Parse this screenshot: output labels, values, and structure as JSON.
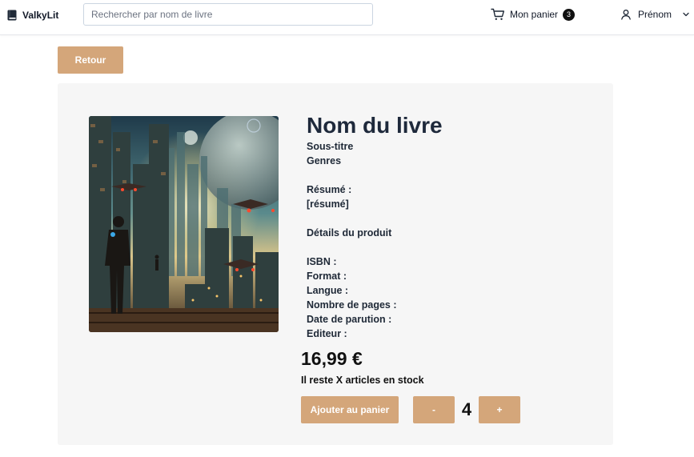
{
  "header": {
    "brand_name": "ValkyLit",
    "search_placeholder": "Rechercher par nom de livre",
    "cart_label": "Mon panier",
    "cart_count": "3",
    "user_name": "Prénom"
  },
  "back_label": "Retour",
  "product": {
    "title": "Nom du livre",
    "subtitle": "Sous-titre",
    "genres": "Genres",
    "summary_label": "Résumé :",
    "summary_value": "[résumé]",
    "details_heading": "Détails du produit",
    "isbn_label": "ISBN :",
    "format_label": "Format :",
    "language_label": "Langue :",
    "pages_label": "Nombre de pages :",
    "release_label": "Date de parution :",
    "publisher_label": "Editeur :",
    "price": "16,99 €",
    "stock_text": "Il reste X articles en stock",
    "add_to_cart_label": "Ajouter au panier",
    "minus_label": "-",
    "quantity": "4",
    "plus_label": "+"
  },
  "colors": {
    "accent": "#d4a67a",
    "panel_bg": "#f6f6f6",
    "title": "#1e293b"
  },
  "icons": [
    "book-icon",
    "cart-icon",
    "user-icon",
    "chevron-down-icon"
  ]
}
